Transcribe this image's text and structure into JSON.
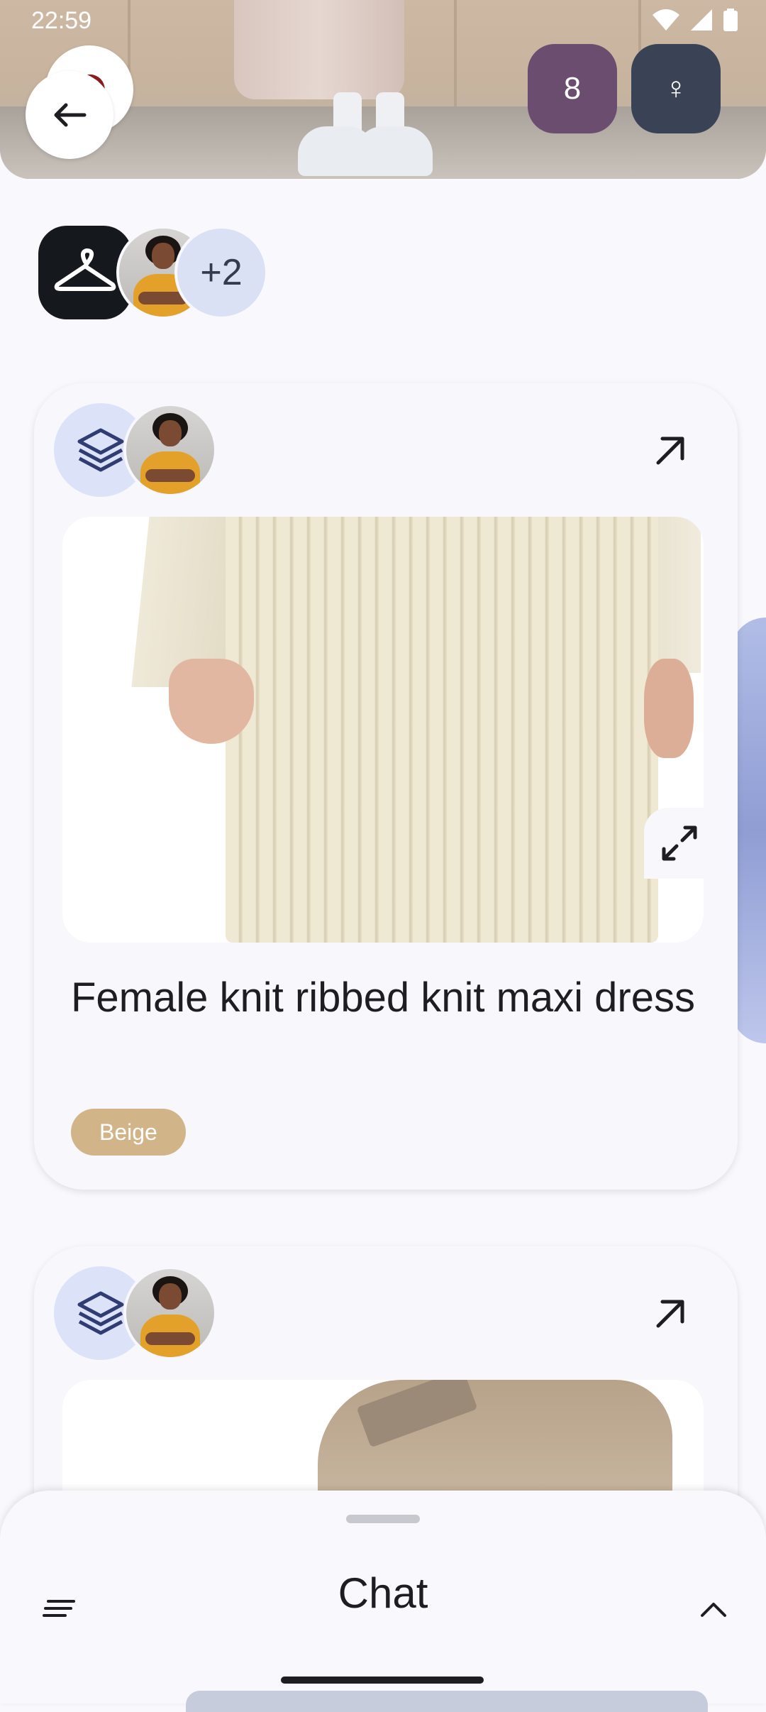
{
  "status_bar": {
    "time": "22:59"
  },
  "header": {
    "count_badge": "8",
    "gender_symbol": "♀"
  },
  "participants": {
    "extra_count": "+2"
  },
  "cards": [
    {
      "title": "Female  knit ribbed knit maxi dress",
      "color_chip": "Beige",
      "chip_color": "#d1b487"
    },
    {
      "title": "",
      "color_chip": ""
    }
  ],
  "chat_sheet": {
    "title": "Chat"
  },
  "colors": {
    "count_badge_bg": "#6b4d70",
    "gender_badge_bg": "#3a4356",
    "layers_icon": "#2f3d73",
    "hanger_bg": "#15181c"
  }
}
